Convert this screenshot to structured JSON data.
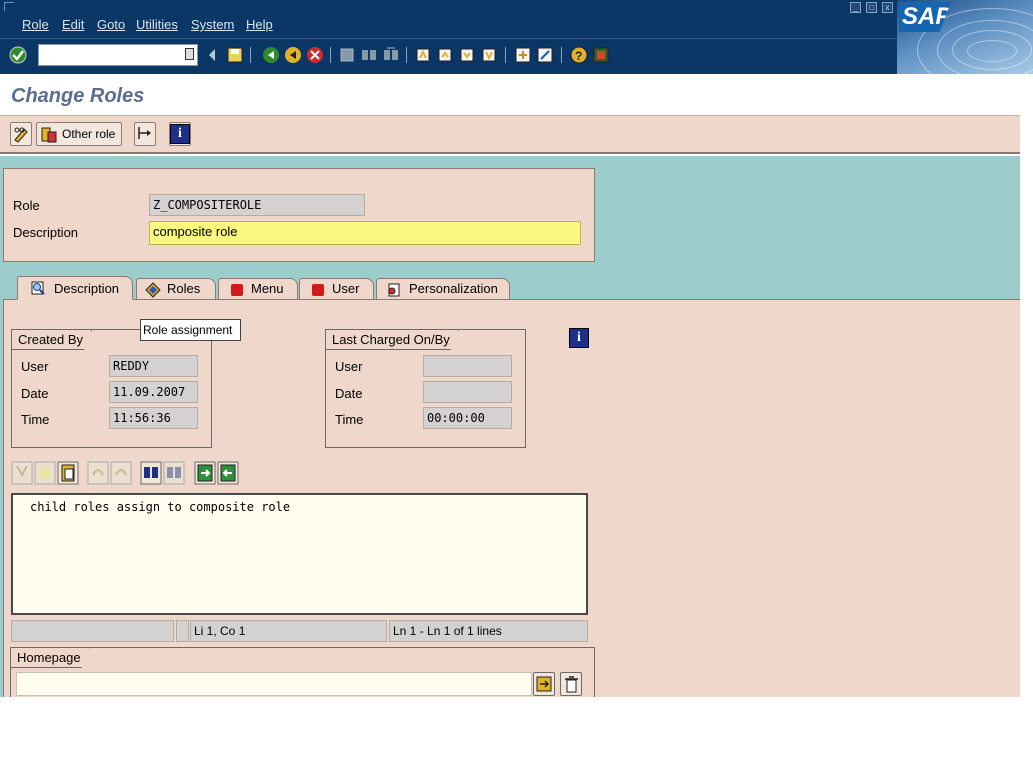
{
  "menubar": {
    "items": [
      "Role",
      "Edit",
      "Goto",
      "Utilities",
      "System",
      "Help"
    ],
    "logo": "SAP"
  },
  "toolbar": {
    "command_value": ""
  },
  "page": {
    "title": "Change Roles"
  },
  "app_toolbar": {
    "other_role_label": "Other role"
  },
  "header": {
    "role_label": "Role",
    "role_value": "Z_COMPOSITEROLE",
    "description_label": "Description",
    "description_value": "composite role"
  },
  "tabs": [
    {
      "label": "Description",
      "icon": "magnifier-doc-icon",
      "active": true
    },
    {
      "label": "Roles",
      "icon": "diamond-roles-icon",
      "active": false
    },
    {
      "label": "Menu",
      "icon": "red-status-icon",
      "active": false
    },
    {
      "label": "User",
      "icon": "red-status-icon",
      "active": false
    },
    {
      "label": "Personalization",
      "icon": "personalization-icon",
      "active": false
    }
  ],
  "tooltip": "Role assignment",
  "created_by": {
    "title": "Created By",
    "user_label": "User",
    "user_value": "REDDY",
    "date_label": "Date",
    "date_value": "11.09.2007",
    "time_label": "Time",
    "time_value": "11:56:36"
  },
  "last_changed": {
    "title": "Last Charged On/By",
    "user_label": "User",
    "user_value": "",
    "date_label": "Date",
    "date_value": "",
    "time_label": "Time",
    "time_value": "00:00:00"
  },
  "editor": {
    "text": "child roles assign to composite role",
    "status_position": "Li 1, Co 1",
    "status_lines": "Ln 1 - Ln 1 of 1 lines"
  },
  "homepage": {
    "title": "Homepage",
    "value": ""
  },
  "colors": {
    "menubar": "#0b3766",
    "panel": "#efd8cb",
    "background": "#9ccccc",
    "title": "#5a6d92",
    "required_field": "#fbf87f"
  }
}
